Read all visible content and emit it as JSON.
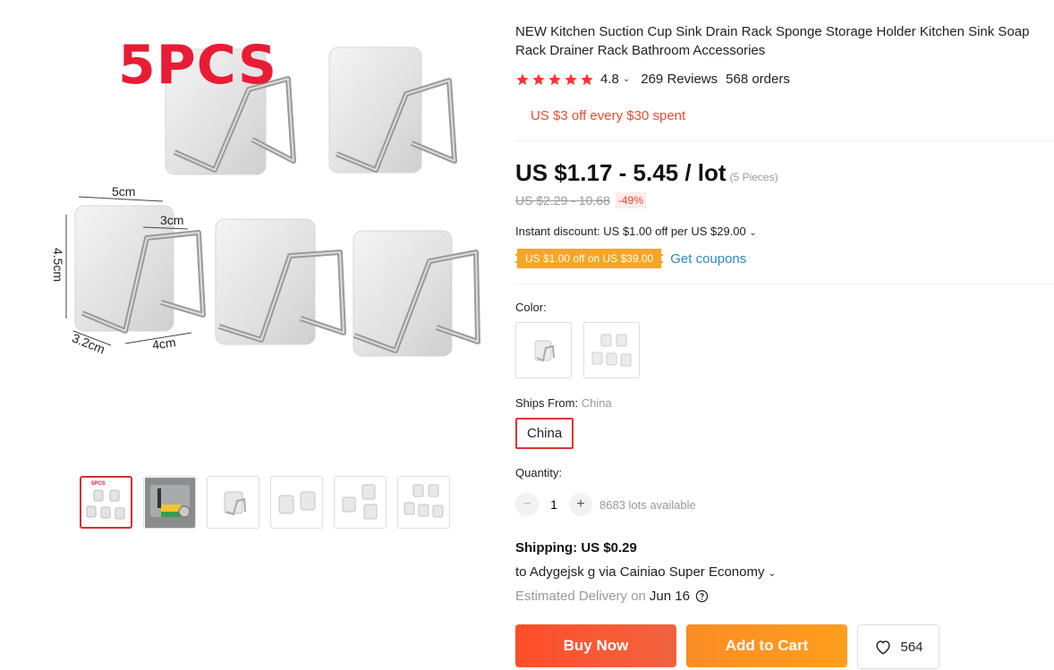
{
  "gallery": {
    "promo_text": "5PCS",
    "dimensions": {
      "width_top": "5cm",
      "hook_depth": "3cm",
      "height": "4.5cm",
      "base_depth": "3.2cm",
      "hook_width": "4cm"
    },
    "thumbnails": [
      {
        "icon": "rack-set-5pcs",
        "caption": "5PCS",
        "active": true
      },
      {
        "icon": "rack-in-use-photo",
        "active": false
      },
      {
        "icon": "rack-single",
        "active": false
      },
      {
        "icon": "rack-pair",
        "active": false
      },
      {
        "icon": "rack-set-3",
        "active": false
      },
      {
        "icon": "rack-set-5",
        "active": false
      }
    ]
  },
  "product": {
    "title": "NEW Kitchen Suction Cup Sink Drain Rack Sponge Storage Holder Kitchen Sink Soap Rack Drainer Rack Bathroom Accessories",
    "rating": "4.8",
    "stars": 5,
    "reviews": "269 Reviews",
    "orders": "568 orders",
    "store_promo": "US $3 off every $30 spent",
    "price": "US $1.17 - 5.45 / lot",
    "pieces": "(5 Pieces)",
    "old_price": "US $2.29 - 10.68",
    "discount_pct": "-49%",
    "instant_discount": "Instant discount: US $1.00 off per US $29.00",
    "coupon_tag": "US $1.00 off on US $39.00",
    "get_coupons": "Get coupons"
  },
  "sku": {
    "color_label": "Color:",
    "color_options": [
      "single rack",
      "5 rack set"
    ],
    "ships_from_label": "Ships From:",
    "ships_from_value": "China",
    "ships_option": "China",
    "quantity_label": "Quantity:",
    "quantity_minus": "−",
    "quantity_plus": "+",
    "quantity": "1",
    "available": "8683 lots available"
  },
  "shipping": {
    "cost": "Shipping: US $0.29",
    "to": "to Adygejsk g via Cainiao Super Economy",
    "delivery_label": "Estimated Delivery on",
    "delivery_date": "Jun 16"
  },
  "actions": {
    "buy_now": "Buy Now",
    "add_to_cart": "Add to Cart",
    "wishlist_count": "564"
  },
  "colors": {
    "accent_red": "#e81c35",
    "star": "#ff3333",
    "buy_now": "#ff4e2a",
    "add_to_cart": "#fa8c25",
    "coupon": "#f5a623",
    "link": "#2e8ab8"
  }
}
